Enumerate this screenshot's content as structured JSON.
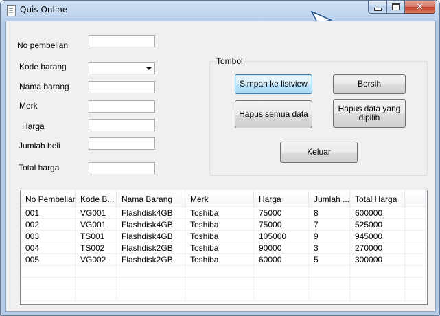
{
  "window": {
    "title": "Quis Online",
    "caption_buttons": {
      "minimize": "minimize-icon",
      "maximize": "maximize-icon",
      "close": "close-icon"
    }
  },
  "form": {
    "no_pembelian_label": "No pembelian",
    "kode_barang_label": "Kode barang",
    "nama_barang_label": "Nama barang",
    "merk_label": "Merk",
    "harga_label": "Harga",
    "jumlah_beli_label": "Jumlah beli",
    "total_harga_label": "Total harga",
    "no_pembelian_value": "",
    "kode_barang_value": "",
    "nama_barang_value": "",
    "merk_value": "",
    "harga_value": "",
    "jumlah_beli_value": "",
    "total_harga_value": ""
  },
  "tombol": {
    "group_title": "Tombol",
    "simpan_label": "Simpan ke listview",
    "bersih_label": "Bersih",
    "hapus_semua_label": "Hapus semua data",
    "hapus_dipilih_line1": "Hapus data yang",
    "hapus_dipilih_line2": "dipilih",
    "keluar_label": "Keluar"
  },
  "listview": {
    "columns": [
      "No Pembelian",
      "Kode B...",
      "Nama Barang",
      "Merk",
      "Harga",
      "Jumlah ...",
      "Total Harga"
    ],
    "rows": [
      [
        "001",
        "VG001",
        "Flashdisk4GB",
        "Toshiba",
        "75000",
        "8",
        "600000"
      ],
      [
        "002",
        "VG001",
        "Flashdisk4GB",
        "Toshiba",
        "75000",
        "7",
        "525000"
      ],
      [
        "003",
        "TS001",
        "Flashdisk4GB",
        "Toshiba",
        "105000",
        "9",
        "945000"
      ],
      [
        "004",
        "TS002",
        "Flashdisk2GB",
        "Toshiba",
        "90000",
        "3",
        "270000"
      ],
      [
        "005",
        "VG002",
        "Flashdisk2GB",
        "Toshiba",
        "60000",
        "5",
        "300000"
      ]
    ]
  },
  "colors": {
    "accent": "#3c7fb1",
    "titlebar": "#bcd3ee",
    "client_bg": "#f0f0f0",
    "close_button": "#c3412a"
  }
}
